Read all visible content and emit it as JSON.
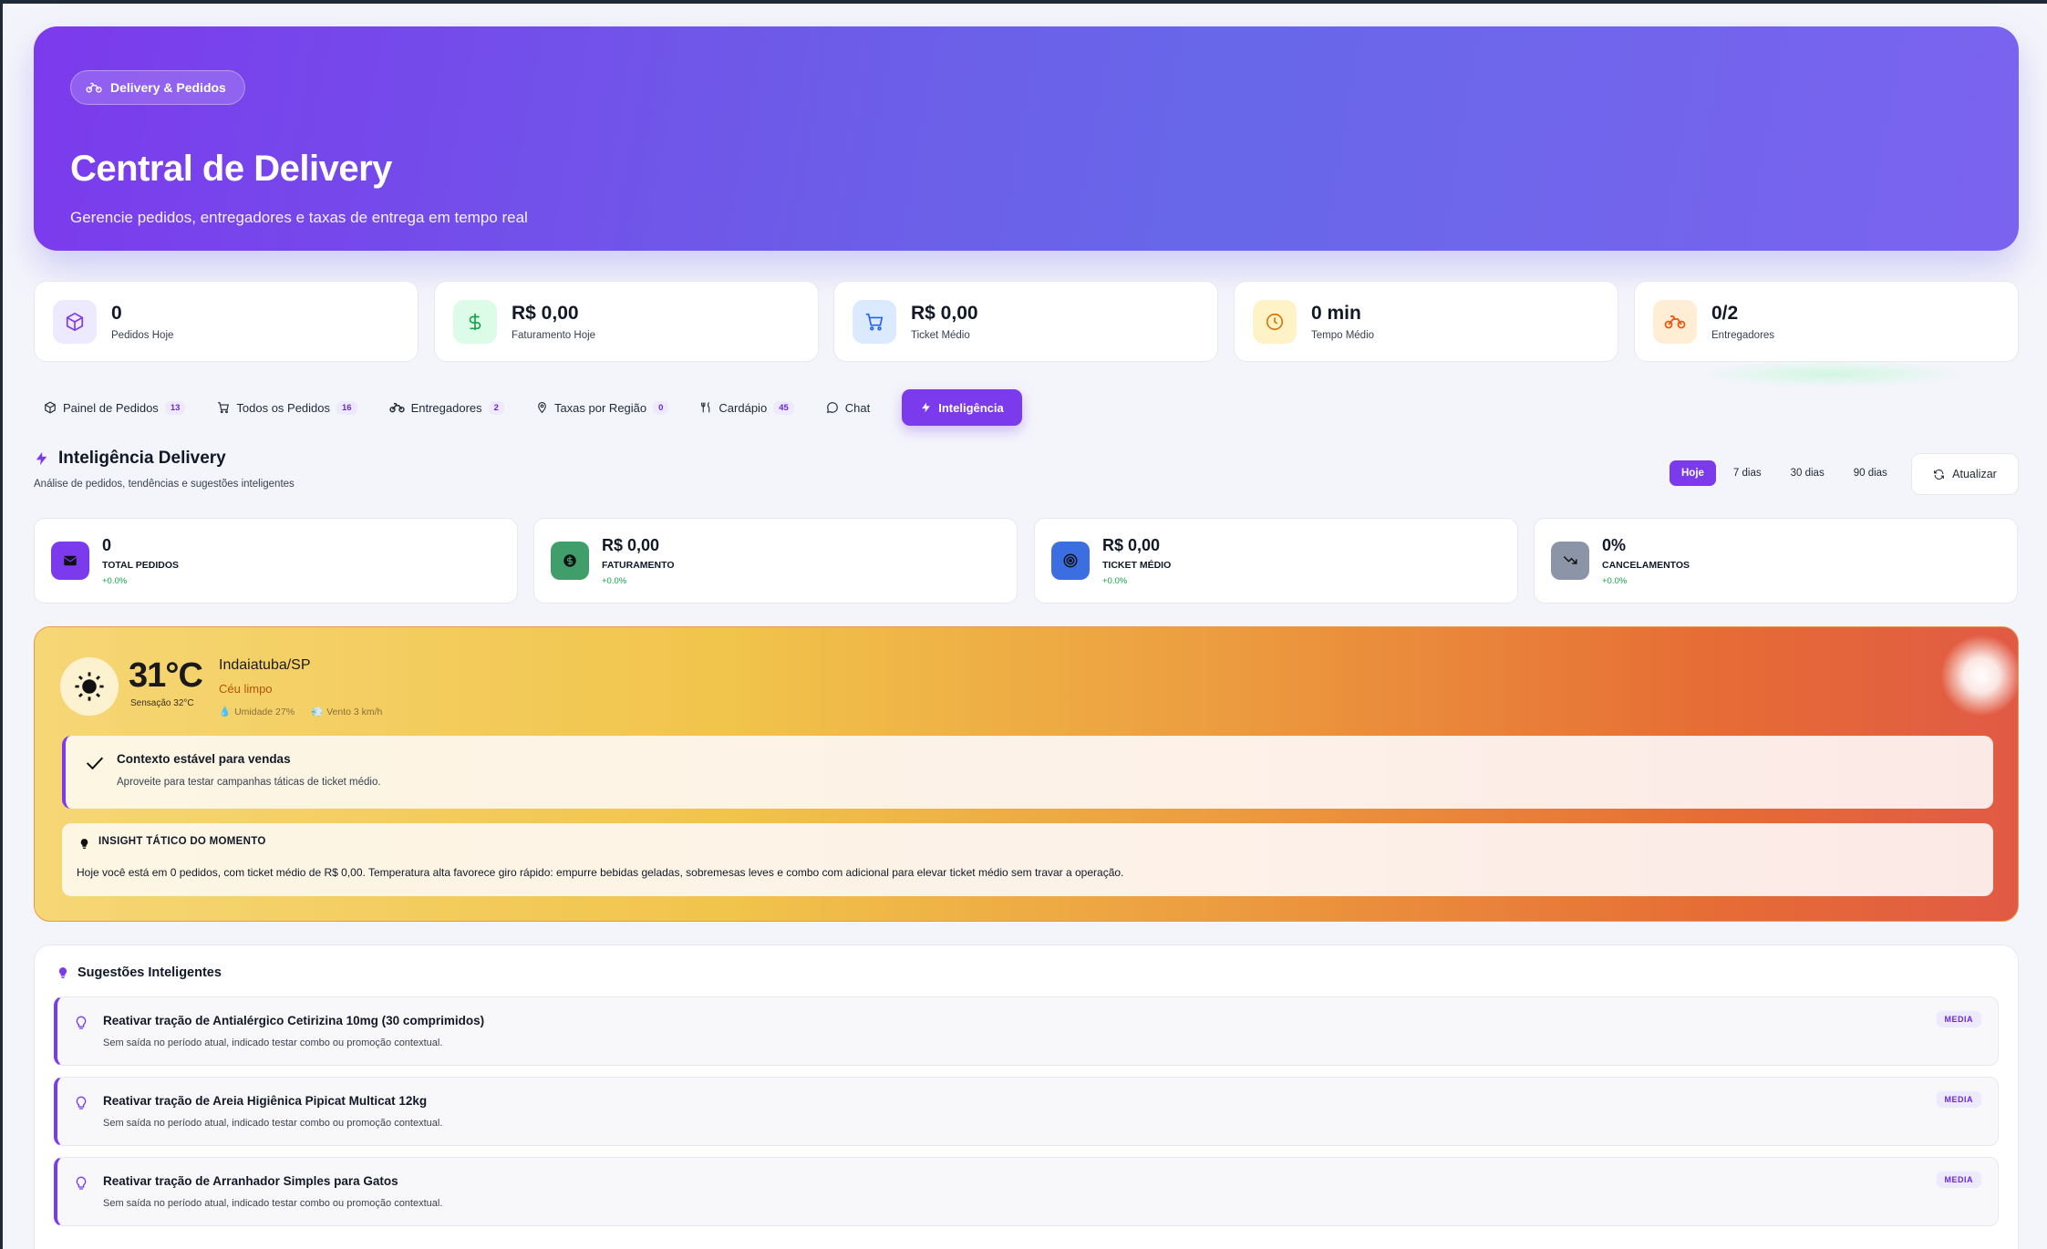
{
  "hero": {
    "pill_label": "Delivery & Pedidos",
    "title": "Central de Delivery",
    "subtitle": "Gerencie pedidos, entregadores e taxas de entrega em tempo real"
  },
  "stats": [
    {
      "value": "0",
      "label": "Pedidos Hoje",
      "icon": "box-icon",
      "color": "#7c3aed"
    },
    {
      "value": "R$ 0,00",
      "label": "Faturamento Hoje",
      "icon": "dollar-icon",
      "color": "#16a34a"
    },
    {
      "value": "R$ 0,00",
      "label": "Ticket Médio",
      "icon": "cart-icon",
      "color": "#2563eb"
    },
    {
      "value": "0 min",
      "label": "Tempo Médio",
      "icon": "clock-icon",
      "color": "#d97706"
    },
    {
      "value": "0/2",
      "label": "Entregadores",
      "icon": "motorcycle-icon",
      "color": "#ea580c"
    }
  ],
  "tabs": [
    {
      "label": "Painel de Pedidos",
      "count": "13",
      "icon": "box-icon"
    },
    {
      "label": "Todos os Pedidos",
      "count": "16",
      "icon": "cart-icon"
    },
    {
      "label": "Entregadores",
      "count": "2",
      "icon": "motorcycle-icon"
    },
    {
      "label": "Taxas por Região",
      "count": "0",
      "icon": "pin-icon"
    },
    {
      "label": "Cardápio",
      "count": "45",
      "icon": "utensils-icon"
    },
    {
      "label": "Chat",
      "icon": "chat-icon"
    },
    {
      "label": "Inteligência",
      "icon": "bolt-icon",
      "active": true
    }
  ],
  "section": {
    "title": "Inteligência Delivery",
    "subtitle": "Análise de pedidos, tendências e sugestões inteligentes"
  },
  "ranges": [
    "Hoje",
    "7 dias",
    "30 dias",
    "90 dias"
  ],
  "refresh_label": "Atualizar",
  "kpis": [
    {
      "value": "0",
      "label": "TOTAL PEDIDOS",
      "delta": "+0.0%",
      "color": "#7c3aed",
      "icon": "inbox-icon"
    },
    {
      "value": "R$ 0,00",
      "label": "FATURAMENTO",
      "delta": "+0.0%",
      "color": "#16a34a",
      "icon": "dollar-icon"
    },
    {
      "value": "R$ 0,00",
      "label": "TICKET MÉDIO",
      "delta": "+0.0%",
      "color": "#2563eb",
      "icon": "target-icon"
    },
    {
      "value": "0%",
      "label": "CANCELAMENTOS",
      "delta": "+0.0%",
      "color": "#64748b",
      "icon": "trend-down-icon"
    }
  ],
  "weather": {
    "temperature": "31°C",
    "feels_like": "Sensação 32°C",
    "city": "Indaiatuba/SP",
    "condition": "Céu limpo",
    "humidity": "Umidade 27%",
    "wind": "Vento 3 km/h"
  },
  "context": {
    "title": "Contexto estável para vendas",
    "subtitle": "Aproveite para testar campanhas táticas de ticket médio."
  },
  "insight": {
    "title": "INSIGHT TÁTICO DO MOMENTO",
    "text": "Hoje você está em 0 pedidos, com ticket médio de R$ 0,00. Temperatura alta favorece giro rápido: empurre bebidas geladas, sobremesas leves e combo com adicional para elevar ticket médio sem travar a operação."
  },
  "suggestions": {
    "title": "Sugestões Inteligentes",
    "items": [
      {
        "name": "Reativar tração de Antialérgico Cetirizina 10mg (30 comprimidos)",
        "desc": "Sem saída no período atual, indicado testar combo ou promoção contextual.",
        "badge": "MEDIA"
      },
      {
        "name": "Reativar tração de Areia Higiênica Pipicat Multicat 12kg",
        "desc": "Sem saída no período atual, indicado testar combo ou promoção contextual.",
        "badge": "MEDIA"
      },
      {
        "name": "Reativar tração de Arranhador Simples para Gatos",
        "desc": "Sem saída no período atual, indicado testar combo ou promoção contextual.",
        "badge": "MEDIA"
      }
    ]
  }
}
